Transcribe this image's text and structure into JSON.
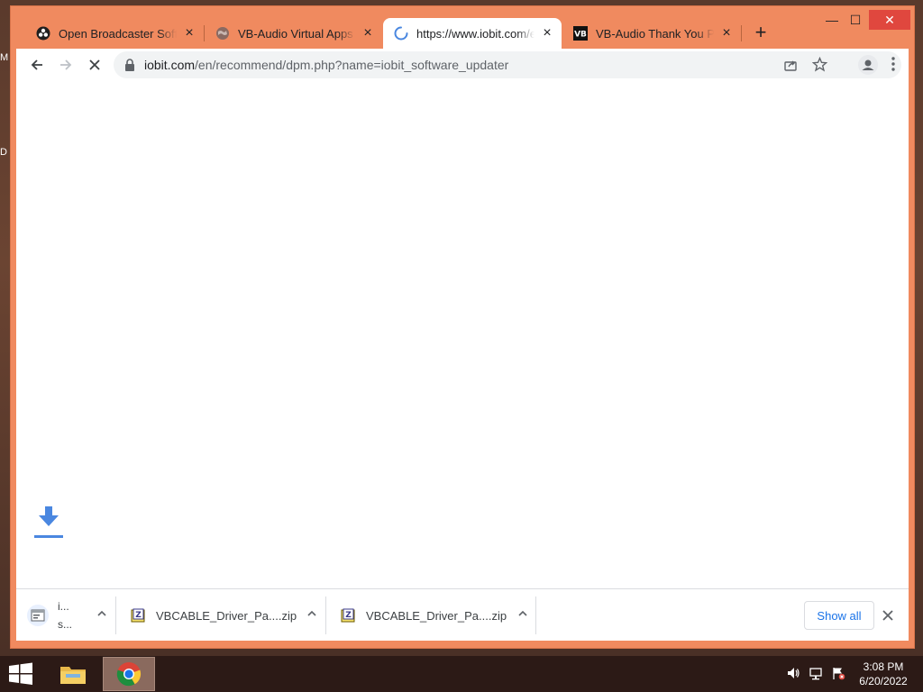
{
  "desktop": {
    "labels": [
      "M",
      "D"
    ]
  },
  "browser": {
    "tabs": [
      {
        "title": "Open Broadcaster Software",
        "favicon": "obs-icon",
        "active": false
      },
      {
        "title": "VB-Audio Virtual Apps",
        "favicon": "globe-icon",
        "active": false
      },
      {
        "title": "https://www.iobit.com/en/recommend",
        "favicon": "loading-spinner-icon",
        "active": true
      },
      {
        "title": "VB-Audio Thank You Page",
        "favicon": "vb-logo-icon",
        "active": false
      }
    ],
    "new_tab_label": "+",
    "window_controls": {
      "minimize": "—",
      "maximize": "☐",
      "close": "✕"
    },
    "toolbar": {
      "back": "back-arrow-icon",
      "forward": "forward-arrow-icon",
      "stop": "stop-loading-icon",
      "url_host": "iobit.com",
      "url_path": "/en/recommend/dpm.php?name=iobit_software_updater",
      "share": "share-icon",
      "bookmark": "star-icon",
      "profile": "profile-icon",
      "menu": "kebab-menu-icon"
    },
    "downloads": [
      {
        "name_line1": "i...",
        "name_line2": "s...",
        "icon": "installer-file-icon"
      },
      {
        "name": "VBCABLE_Driver_Pa....zip",
        "icon": "zip-file-icon"
      },
      {
        "name": "VBCABLE_Driver_Pa....zip",
        "icon": "zip-file-icon"
      }
    ],
    "show_all_label": "Show all",
    "close_downloads": "close-icon"
  },
  "taskbar": {
    "apps": [
      "file-explorer-icon",
      "chrome-icon"
    ],
    "tray_icons": [
      "volume-icon",
      "network-icon",
      "action-center-flag-icon"
    ],
    "time": "3:08 PM",
    "date": "6/20/2022"
  },
  "colors": {
    "titlebar": "#f08a5f",
    "accent": "#1a73e8",
    "download_arrow": "#4a87e0"
  }
}
